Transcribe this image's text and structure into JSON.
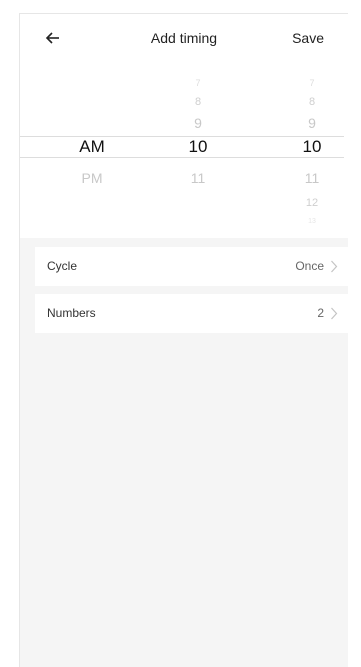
{
  "header": {
    "title": "Add timing",
    "save_label": "Save",
    "back_icon": "arrow-left-icon"
  },
  "picker": {
    "period": {
      "items": [
        "AM",
        "PM"
      ],
      "selected": "AM"
    },
    "hour": {
      "items": [
        "7",
        "8",
        "9",
        "10",
        "11"
      ],
      "selected": "10"
    },
    "minute": {
      "items": [
        "7",
        "8",
        "9",
        "10",
        "11",
        "12",
        "13"
      ],
      "selected": "10"
    }
  },
  "settings": [
    {
      "label": "Cycle",
      "value": "Once",
      "icon": "chevron-right-icon"
    },
    {
      "label": "Numbers",
      "value": "2",
      "icon": "chevron-right-icon"
    }
  ],
  "colors": {
    "background": "#f5f5f5",
    "panel": "#ffffff",
    "text": "#222222",
    "muted": "#c8c8c8",
    "divider": "#dddddd"
  }
}
